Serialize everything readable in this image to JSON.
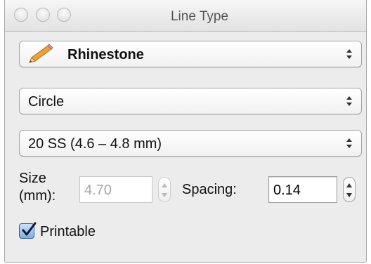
{
  "window": {
    "title": "Line Type"
  },
  "line_type_popup": {
    "selected": "Rhinestone",
    "icon": "pencil-icon"
  },
  "shape_popup": {
    "selected": "Circle"
  },
  "stone_size_popup": {
    "selected": "20 SS (4.6 – 4.8 mm)"
  },
  "size": {
    "label_line1": "Size",
    "label_line2": "(mm):",
    "value": "4.70",
    "enabled": false
  },
  "spacing": {
    "label": "Spacing:",
    "value": "0.14",
    "enabled": true
  },
  "printable": {
    "label": "Printable",
    "checked": true
  },
  "colors": {
    "accent": "#4a86d8",
    "pencil": "#e9a23b"
  }
}
